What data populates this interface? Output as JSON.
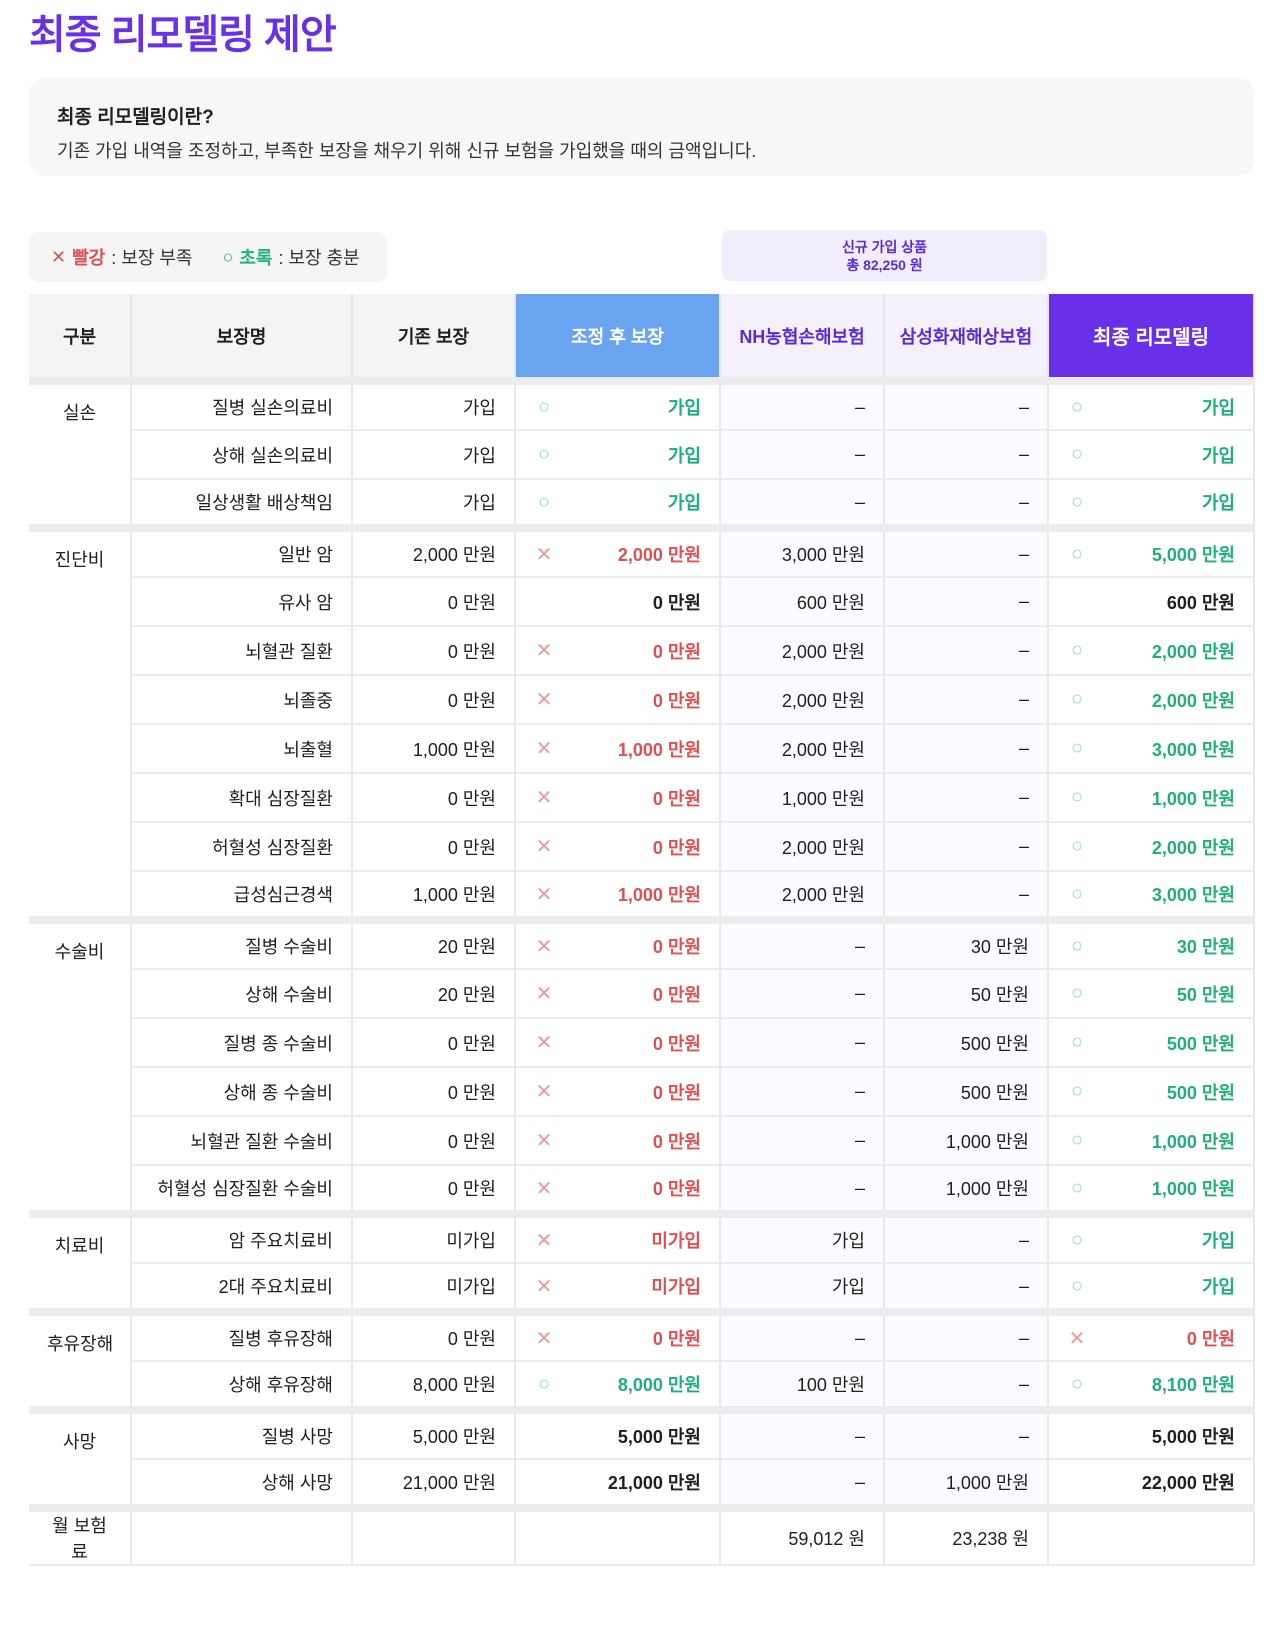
{
  "page_title": "최종 리모델링 제안",
  "info": {
    "title": "최종 리모델링이란?",
    "description": "기존 가입 내역을 조정하고, 부족한 보장을 채우기 위해 신규 보험을 가입했을 때의 금액입니다."
  },
  "legend": {
    "red_mark": "✕",
    "red_label": "빨강",
    "red_desc": ": 보장 부족",
    "green_mark": "○",
    "green_label": "초록",
    "green_desc": ": 보장 충분"
  },
  "new_products": {
    "line1": "신규 가입 상품",
    "line2": "총 82,250 원"
  },
  "headers": [
    "구분",
    "보장명",
    "기존 보장",
    "조정 후 보장",
    "NH농협손해보험",
    "삼성화재해상보험",
    "최종 리모델링"
  ],
  "colors": {
    "accent": "#6a2fe8",
    "adjust_header": "#6aa3ef",
    "red": "#e0504f",
    "green": "#1fae7e"
  },
  "groups": [
    {
      "category": "실손",
      "rows": [
        {
          "name": "질병 실손의료비",
          "existing": "가입",
          "adj_mark": "○",
          "adjusted": "가입",
          "adj_style": "green",
          "nh": "–",
          "samsung": "–",
          "final_mark": "○",
          "final": "가입",
          "final_style": "green"
        },
        {
          "name": "상해 실손의료비",
          "existing": "가입",
          "adj_mark": "○",
          "adjusted": "가입",
          "adj_style": "green",
          "nh": "–",
          "samsung": "–",
          "final_mark": "○",
          "final": "가입",
          "final_style": "green"
        },
        {
          "name": "일상생활 배상책임",
          "existing": "가입",
          "adj_mark": "○",
          "adjusted": "가입",
          "adj_style": "green",
          "nh": "–",
          "samsung": "–",
          "final_mark": "○",
          "final": "가입",
          "final_style": "green"
        }
      ]
    },
    {
      "category": "진단비",
      "rows": [
        {
          "name": "일반 암",
          "existing": "2,000 만원",
          "adj_mark": "✕",
          "adjusted": "2,000 만원",
          "adj_style": "red",
          "nh": "3,000 만원",
          "samsung": "–",
          "final_mark": "○",
          "final": "5,000 만원",
          "final_style": "green"
        },
        {
          "name": "유사 암",
          "existing": "0 만원",
          "adj_mark": "",
          "adjusted": "0 만원",
          "adj_style": "bold",
          "nh": "600 만원",
          "samsung": "–",
          "final_mark": "",
          "final": "600 만원",
          "final_style": "bold"
        },
        {
          "name": "뇌혈관 질환",
          "existing": "0 만원",
          "adj_mark": "✕",
          "adjusted": "0 만원",
          "adj_style": "red",
          "nh": "2,000 만원",
          "samsung": "–",
          "final_mark": "○",
          "final": "2,000 만원",
          "final_style": "green"
        },
        {
          "name": "뇌졸중",
          "existing": "0 만원",
          "adj_mark": "✕",
          "adjusted": "0 만원",
          "adj_style": "red",
          "nh": "2,000 만원",
          "samsung": "–",
          "final_mark": "○",
          "final": "2,000 만원",
          "final_style": "green"
        },
        {
          "name": "뇌출혈",
          "existing": "1,000 만원",
          "adj_mark": "✕",
          "adjusted": "1,000 만원",
          "adj_style": "red",
          "nh": "2,000 만원",
          "samsung": "–",
          "final_mark": "○",
          "final": "3,000 만원",
          "final_style": "green"
        },
        {
          "name": "확대 심장질환",
          "existing": "0 만원",
          "adj_mark": "✕",
          "adjusted": "0 만원",
          "adj_style": "red",
          "nh": "1,000 만원",
          "samsung": "–",
          "final_mark": "○",
          "final": "1,000 만원",
          "final_style": "green"
        },
        {
          "name": "허혈성 심장질환",
          "existing": "0 만원",
          "adj_mark": "✕",
          "adjusted": "0 만원",
          "adj_style": "red",
          "nh": "2,000 만원",
          "samsung": "–",
          "final_mark": "○",
          "final": "2,000 만원",
          "final_style": "green"
        },
        {
          "name": "급성심근경색",
          "existing": "1,000 만원",
          "adj_mark": "✕",
          "adjusted": "1,000 만원",
          "adj_style": "red",
          "nh": "2,000 만원",
          "samsung": "–",
          "final_mark": "○",
          "final": "3,000 만원",
          "final_style": "green"
        }
      ]
    },
    {
      "category": "수술비",
      "rows": [
        {
          "name": "질병 수술비",
          "existing": "20 만원",
          "adj_mark": "✕",
          "adjusted": "0 만원",
          "adj_style": "red",
          "nh": "–",
          "samsung": "30 만원",
          "final_mark": "○",
          "final": "30 만원",
          "final_style": "green"
        },
        {
          "name": "상해 수술비",
          "existing": "20 만원",
          "adj_mark": "✕",
          "adjusted": "0 만원",
          "adj_style": "red",
          "nh": "–",
          "samsung": "50 만원",
          "final_mark": "○",
          "final": "50 만원",
          "final_style": "green"
        },
        {
          "name": "질병 종 수술비",
          "existing": "0 만원",
          "adj_mark": "✕",
          "adjusted": "0 만원",
          "adj_style": "red",
          "nh": "–",
          "samsung": "500 만원",
          "final_mark": "○",
          "final": "500 만원",
          "final_style": "green"
        },
        {
          "name": "상해 종 수술비",
          "existing": "0 만원",
          "adj_mark": "✕",
          "adjusted": "0 만원",
          "adj_style": "red",
          "nh": "–",
          "samsung": "500 만원",
          "final_mark": "○",
          "final": "500 만원",
          "final_style": "green"
        },
        {
          "name": "뇌혈관 질환 수술비",
          "existing": "0 만원",
          "adj_mark": "✕",
          "adjusted": "0 만원",
          "adj_style": "red",
          "nh": "–",
          "samsung": "1,000 만원",
          "final_mark": "○",
          "final": "1,000 만원",
          "final_style": "green"
        },
        {
          "name": "허혈성 심장질환 수술비",
          "existing": "0 만원",
          "adj_mark": "✕",
          "adjusted": "0 만원",
          "adj_style": "red",
          "nh": "–",
          "samsung": "1,000 만원",
          "final_mark": "○",
          "final": "1,000 만원",
          "final_style": "green"
        }
      ]
    },
    {
      "category": "치료비",
      "rows": [
        {
          "name": "암 주요치료비",
          "existing": "미가입",
          "adj_mark": "✕",
          "adjusted": "미가입",
          "adj_style": "red",
          "nh": "가입",
          "samsung": "–",
          "final_mark": "○",
          "final": "가입",
          "final_style": "green"
        },
        {
          "name": "2대 주요치료비",
          "existing": "미가입",
          "adj_mark": "✕",
          "adjusted": "미가입",
          "adj_style": "red",
          "nh": "가입",
          "samsung": "–",
          "final_mark": "○",
          "final": "가입",
          "final_style": "green"
        }
      ]
    },
    {
      "category": "후유장해",
      "rows": [
        {
          "name": "질병 후유장해",
          "existing": "0 만원",
          "adj_mark": "✕",
          "adjusted": "0 만원",
          "adj_style": "red",
          "nh": "–",
          "samsung": "–",
          "final_mark": "✕",
          "final": "0 만원",
          "final_style": "red"
        },
        {
          "name": "상해 후유장해",
          "existing": "8,000 만원",
          "adj_mark": "○",
          "adjusted": "8,000 만원",
          "adj_style": "green",
          "nh": "100 만원",
          "samsung": "–",
          "final_mark": "○",
          "final": "8,100 만원",
          "final_style": "green"
        }
      ]
    },
    {
      "category": "사망",
      "rows": [
        {
          "name": "질병 사망",
          "existing": "5,000 만원",
          "adj_mark": "",
          "adjusted": "5,000 만원",
          "adj_style": "bold",
          "nh": "–",
          "samsung": "–",
          "final_mark": "",
          "final": "5,000 만원",
          "final_style": "bold"
        },
        {
          "name": "상해 사망",
          "existing": "21,000 만원",
          "adj_mark": "",
          "adjusted": "21,000 만원",
          "adj_style": "bold",
          "nh": "–",
          "samsung": "1,000 만원",
          "final_mark": "",
          "final": "22,000 만원",
          "final_style": "bold"
        }
      ]
    }
  ],
  "footer": {
    "label": "월 보험료",
    "nh": "59,012 원",
    "samsung": "23,238 원"
  }
}
